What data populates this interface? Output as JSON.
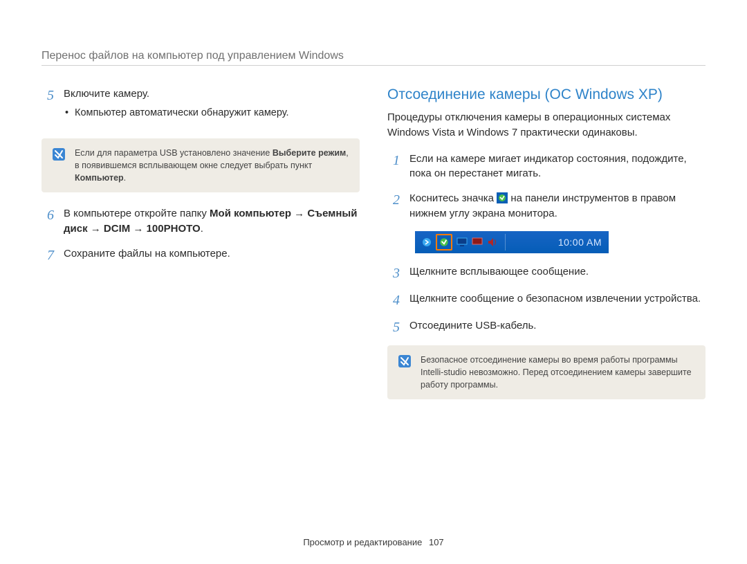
{
  "header": "Перенос файлов на компьютер под управлением Windows",
  "left": {
    "step5": {
      "num": "5",
      "title": "Включите камеру.",
      "bullet": "Компьютер автоматически обнаружит камеру."
    },
    "note": {
      "text_before": "Если для параметра USB установлено значение ",
      "bold1": "Выберите режим",
      "text_mid": ", в появившемся всплывающем окне следует выбрать пункт ",
      "bold2": "Компьютер",
      "text_after": "."
    },
    "step6": {
      "num": "6",
      "text_before": "В компьютере откройте папку ",
      "bold": "Мой компьютер → Съемный диск → DCIM → 100PHOTO",
      "text_after": "."
    },
    "step7": {
      "num": "7",
      "text": "Сохраните файлы на компьютере."
    }
  },
  "right": {
    "title": "Отсоединение камеры (ОС Windows XP)",
    "intro": "Процедуры отключения камеры в операционных системах Windows Vista и Windows 7 практически одинаковы.",
    "step1": {
      "num": "1",
      "text": "Если на камере мигает индикатор состояния, подождите, пока он перестанет мигать."
    },
    "step2": {
      "num": "2",
      "text_before": "Коснитесь значка ",
      "text_after": " на панели инструментов в правом нижнем углу экрана монитора."
    },
    "taskbar_time": "10:00 AM",
    "step3": {
      "num": "3",
      "text": "Щелкните всплывающее сообщение."
    },
    "step4": {
      "num": "4",
      "text": "Щелкните сообщение о безопасном извлечении устройства."
    },
    "step5": {
      "num": "5",
      "text": "Отсоедините USB-кабель."
    },
    "note": "Безопасное отсоединение камеры во время работы программы Intelli-studio невозможно. Перед отсоединением камеры завершите работу программы."
  },
  "footer": {
    "label": "Просмотр и редактирование",
    "page": "107"
  }
}
